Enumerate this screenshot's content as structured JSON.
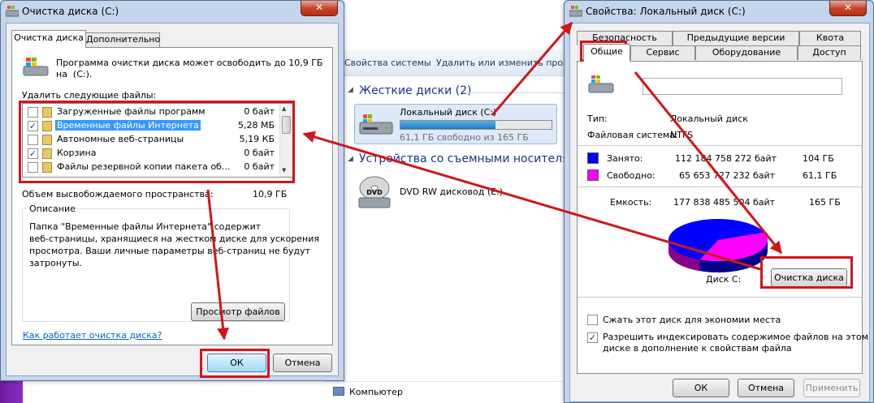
{
  "explorer": {
    "toolbar_items": [
      "Свойства системы",
      "Удалить или изменить прог"
    ],
    "hard_disks_header": "Жесткие диски (2)",
    "local_disk_name": "Локальный диск (C:)",
    "local_disk_free": "61,1 ГБ свободно из 165 ГБ",
    "local_disk_used_fraction": 0.63,
    "removable_header": "Устройства со съемными носителям",
    "dvd_name": "DVD RW дисковод (E:)",
    "dvd_icon_label": "DVD",
    "bottom_item": "Компьютер"
  },
  "cleanup": {
    "title": "Очистка диска  (C:)",
    "close_label": "✕",
    "tabs": [
      "Очистка диска",
      "Дополнительно"
    ],
    "intro": "Программа очистки диска может освободить до 10,9 ГБ\nна  (C:).",
    "delete_label": "Удалить следующие файлы:",
    "files": [
      {
        "name": "Загруженные файлы программ",
        "size": "0 байт",
        "checked": false
      },
      {
        "name": "Временные файлы Интернета",
        "size": "5,28 МБ",
        "checked": true
      },
      {
        "name": "Автономные веб-страницы",
        "size": "5,19 КБ",
        "checked": false
      },
      {
        "name": "Корзина",
        "size": "0 байт",
        "checked": true
      },
      {
        "name": "Файлы резервной копии пакета об...",
        "size": "0 байт",
        "checked": false
      }
    ],
    "freed_label": "Объем высвобождаемого пространства:",
    "freed_value": "10,9 ГБ",
    "description_group": "Описание",
    "description_text": "Папка \"Временные файлы Интернета\" содержит\nвеб-страницы, хранящиеся на жестком диске для ускорения\nпросмотра. Ваши личные параметры веб-страниц не будут\nзатронуты.",
    "view_files_button": "Просмотр файлов",
    "help_link": "Как работает очистка диска?",
    "ok_button": "ОК",
    "cancel_button": "Отмена"
  },
  "properties": {
    "title": "Свойства: Локальный диск (C:)",
    "close_label": "✕",
    "tabs_row1": [
      "Безопасность",
      "Предыдущие версии",
      "Квота"
    ],
    "tabs_row2": [
      "Общие",
      "Сервис",
      "Оборудование",
      "Доступ"
    ],
    "type_label": "Тип:",
    "type_value": "Локальный диск",
    "fs_label": "Файловая система:",
    "fs_value": "NTFS",
    "used_label": "Занято:",
    "used_bytes": "112 184 758 272 байт",
    "used_gb": "104 ГБ",
    "used_color": "#0000ff",
    "free_label": "Свободно:",
    "free_bytes": "65 653 727 232 байт",
    "free_gb": "61,1 ГБ",
    "free_color": "#ff00ff",
    "capacity_label": "Емкость:",
    "capacity_bytes": "177 838 485 504 байт",
    "capacity_gb": "165 ГБ",
    "disk_label": "Диск C:",
    "cleanup_button": "Очистка диска",
    "compress_label": "Сжать этот диск для экономии места",
    "compress_checked": false,
    "index_label": "Разрешить индексировать содержимое файлов на этом\nдиске в дополнение к свойствам файла",
    "index_checked": true,
    "ok_button": "ОК",
    "cancel_button": "Отмена",
    "apply_button": "Применить"
  },
  "annotation_color": "#d0161b"
}
